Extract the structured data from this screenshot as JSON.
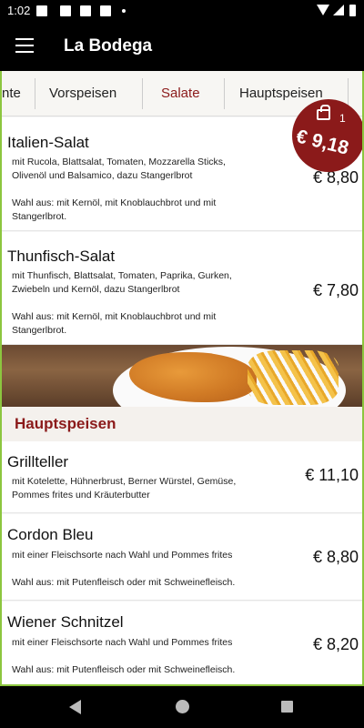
{
  "status_bar": {
    "time": "1:02"
  },
  "app_bar": {
    "title": "La Bodega",
    "menu_icon": "hamburger-menu-icon"
  },
  "tabs": [
    {
      "label": "nte"
    },
    {
      "label": "Vorspeisen"
    },
    {
      "label": "Salate",
      "active": true
    },
    {
      "label": "Hauptspeisen"
    }
  ],
  "salate": [
    {
      "name": "Italien-Salat",
      "description": "mit Rucola, Blattsalat, Tomaten, Mozzarella Sticks, Olivenöl und Balsamico, dazu Stangerlbrot",
      "choice": "Wahl aus: mit Kernöl, mit Knoblauchbrot und mit Stangerlbrot.",
      "price": "€ 8,80"
    },
    {
      "name": "Thunfisch-Salat",
      "description": "mit Thunfisch, Blattsalat, Tomaten, Paprika, Gurken, Zwiebeln und Kernöl, dazu Stangerlbrot",
      "choice": "Wahl aus: mit Kernöl, mit Knoblauchbrot und mit Stangerlbrot.",
      "price": "€ 7,80"
    }
  ],
  "section": {
    "title": "Hauptspeisen"
  },
  "hauptspeisen": [
    {
      "name": "Grillteller",
      "description": "mit Kotelette, Hühnerbrust, Berner Würstel, Gemüse, Pommes frites und Kräuterbutter",
      "price": "€ 11,10"
    },
    {
      "name": "Cordon Bleu",
      "description": "mit einer Fleischsorte nach Wahl und Pommes frites",
      "choice": "Wahl aus: mit Putenfleisch oder mit Schweinefleisch.",
      "price": "€ 8,80"
    },
    {
      "name": "Wiener Schnitzel",
      "description": "mit einer Fleischsorte nach Wahl und Pommes frites",
      "choice": "Wahl aus: mit Putenfleisch oder mit Schweinefleisch.",
      "price": "€ 8,20"
    }
  ],
  "cart": {
    "count": "1",
    "total": "€ 9,18",
    "icon": "shopping-bag-icon"
  },
  "colors": {
    "accent": "#8b1a1a",
    "frame": "#8cc63f",
    "app_bar": "#000000"
  }
}
